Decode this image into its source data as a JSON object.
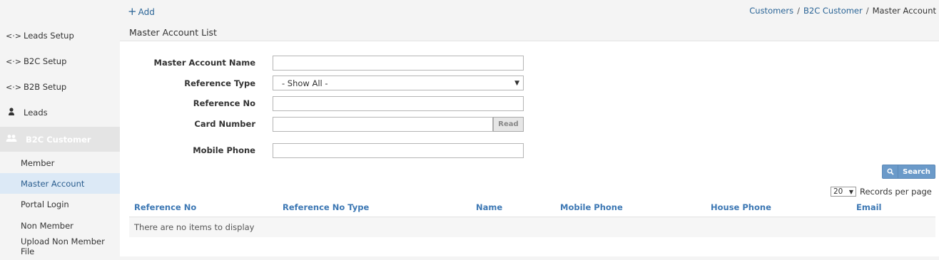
{
  "sidebar": {
    "items": [
      {
        "icon": "<·>",
        "label": "Leads Setup"
      },
      {
        "icon": "<·>",
        "label": "B2C Setup"
      },
      {
        "icon": "<·>",
        "label": "B2B Setup"
      },
      {
        "icon": "👤",
        "label": "Leads"
      }
    ],
    "section": {
      "label": "B2C Customer"
    },
    "sub_items": [
      {
        "label": "Member"
      },
      {
        "label": "Master Account"
      },
      {
        "label": "Portal Login"
      },
      {
        "label": "Non Member"
      },
      {
        "label": "Upload Non Member File"
      }
    ]
  },
  "toolbar": {
    "add_label": "Add"
  },
  "breadcrumb": {
    "items": [
      "Customers",
      "B2C Customer"
    ],
    "current": "Master Account"
  },
  "panel": {
    "title": "Master Account List"
  },
  "form": {
    "master_account_name_label": "Master Account Name",
    "master_account_name_value": "",
    "reference_type_label": "Reference Type",
    "reference_type_value": "- Show All -",
    "reference_no_label": "Reference No",
    "reference_no_value": "",
    "card_number_label": "Card Number",
    "card_number_value": "",
    "read_label": "Read",
    "mobile_phone_label": "Mobile Phone",
    "mobile_phone_value": ""
  },
  "search": {
    "label": "Search"
  },
  "paging": {
    "per_page": "20",
    "label": "Records per page"
  },
  "table": {
    "columns": [
      "Reference No",
      "Reference No Type",
      "Name",
      "Mobile Phone",
      "House Phone",
      "Email"
    ],
    "empty_text": "There are no items to display"
  }
}
